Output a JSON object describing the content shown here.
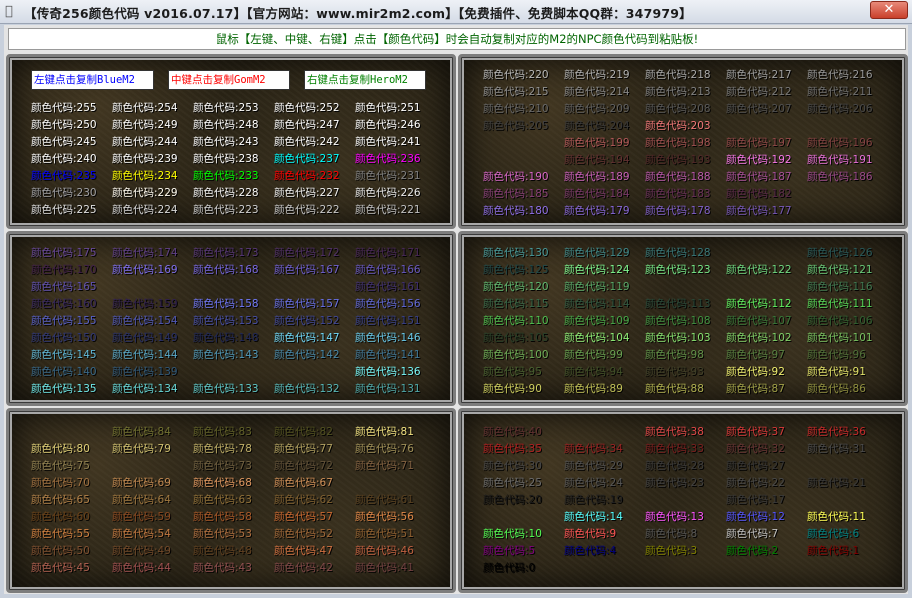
{
  "window": {
    "title": "【传奇256颜色代码 v2016.07.17】【官方网站：www.mir2m2.com】【免费插件、免费脚本QQ群：347979】",
    "close_label": "✕"
  },
  "notice": "鼠标【左键、中键、右键】点击【颜色代码】时会自动复制对应的M2的NPC颜色代码到粘贴板!",
  "buttons": {
    "blue": "左键点击复制BlueM2",
    "gom": "中键点击复制GomM2",
    "hero": "右键点击复制HeroM2"
  },
  "code_prefix": "颜色代码:",
  "palette": [
    "#000000",
    "#800000",
    "#008000",
    "#808000",
    "#000080",
    "#800080",
    "#008080",
    "#c0c0c0",
    "#555555",
    "#ff5555",
    "#55ff55",
    "#ffff55",
    "#5555ff",
    "#ff55ff",
    "#55ffff",
    "#ffffff",
    "#555555",
    "#393939",
    "#2f2f2f",
    "#222222",
    "#1a1a1a",
    "#383838",
    "#484848",
    "#404040",
    "#555555",
    "#6b6b6b",
    "#2a2a2a",
    "#353535",
    "#3a3a3a",
    "#505050",
    "#464646",
    "#4a4a4a",
    "#663333",
    "#7a1e1e",
    "#992222",
    "#b02020",
    "#c72a2a",
    "#d93a3a",
    "#e04848",
    "#b83838",
    "#603030",
    "#704040",
    "#804848",
    "#905050",
    "#a05050",
    "#b06050",
    "#c06040",
    "#d07040",
    "#604020",
    "#704828",
    "#805030",
    "#906030",
    "#a06838",
    "#b07040",
    "#c07840",
    "#d08040",
    "#e08848",
    "#c86830",
    "#a85828",
    "#884820",
    "#684018",
    "#584020",
    "#806030",
    "#907038",
    "#a07840",
    "#b08048",
    "#c08850",
    "#d09058",
    "#e09860",
    "#c08850",
    "#a07040",
    "#806040",
    "#605038",
    "#706040",
    "#807048",
    "#908050",
    "#a09058",
    "#b0a060",
    "#c0b068",
    "#d0c070",
    "#e0d078",
    "#f0e080",
    "#505020",
    "#606028",
    "#707030",
    "#808038",
    "#909040",
    "#a0a048",
    "#b0b050",
    "#c0c058",
    "#d0d060",
    "#e0e068",
    "#f0f070",
    "#404028",
    "#405028",
    "#486030",
    "#507038",
    "#588040",
    "#609048",
    "#68a050",
    "#70b058",
    "#78c060",
    "#80d068",
    "#88e070",
    "#90f078",
    "#284028",
    "#306030",
    "#387838",
    "#409040",
    "#48a848",
    "#50c050",
    "#58d858",
    "#60f060",
    "#284838",
    "#305840",
    "#386848",
    "#407850",
    "#488858",
    "#509860",
    "#58a868",
    "#60b870",
    "#68c878",
    "#70d880",
    "#78e888",
    "#80f890",
    "#204848",
    "#285858",
    "#306868",
    "#387878",
    "#408888",
    "#489898",
    "#50a8a8",
    "#58b8b8",
    "#60c8c8",
    "#68d8d8",
    "#70e8e8",
    "#78f8f8",
    "#203858",
    "#284868",
    "#305878",
    "#386888",
    "#407898",
    "#4888a8",
    "#5098b8",
    "#58a8c8",
    "#60b8d8",
    "#68c8e8",
    "#70d8f8",
    "#202858",
    "#283068",
    "#303878",
    "#384088",
    "#404898",
    "#4850a8",
    "#5058b8",
    "#5860c8",
    "#6068d8",
    "#6870e8",
    "#7078f8",
    "#302050",
    "#382860",
    "#403070",
    "#483880",
    "#504090",
    "#5848a0",
    "#6050b0",
    "#6858c0",
    "#7060d0",
    "#7868e0",
    "#8070f0",
    "#402048",
    "#482858",
    "#503068",
    "#583878",
    "#604088",
    "#684898",
    "#7050a8",
    "#7858b8",
    "#8060c8",
    "#8868d8",
    "#9070e8",
    "#482038",
    "#582848",
    "#683058",
    "#783868",
    "#884078",
    "#984888",
    "#a85098",
    "#b858a8",
    "#c860b8",
    "#d868c8",
    "#e870d8",
    "#f878e8",
    "#502828",
    "#603030",
    "#703838",
    "#804040",
    "#904848",
    "#a05050",
    "#b05858",
    "#c06060",
    "#d06868",
    "#e07070",
    "#f07878",
    "#383838",
    "#404040",
    "#484848",
    "#505050",
    "#585858",
    "#606060",
    "#686868",
    "#707070",
    "#787878",
    "#808080",
    "#888888",
    "#909090",
    "#989898",
    "#a0a0a0",
    "#a8a8a8",
    "#b0b0b0",
    "#b8b8b8",
    "#c0c0c0",
    "#c8c8c8",
    "#d0d0d0",
    "#d8d8d8",
    "#e0e0e0",
    "#e8e8e8",
    "#f0f0f0",
    "#f8f8f8",
    "#fffbf0",
    "#a0a0a4",
    "#808080",
    "#ff0000",
    "#00ff00",
    "#ffff00",
    "#0000ff",
    "#ff00ff",
    "#00ffff",
    "#ffffff"
  ],
  "panels": [
    {
      "name": "panel-255-221",
      "start": 255,
      "visible": [
        255,
        254,
        253,
        252,
        251,
        250,
        249,
        248,
        247,
        246,
        245,
        244,
        243,
        242,
        241,
        240,
        239,
        238,
        237,
        236,
        235,
        234,
        233,
        232,
        231,
        230,
        229,
        228,
        227,
        226,
        225,
        224,
        223,
        222,
        221
      ]
    },
    {
      "name": "panel-220-176",
      "start": 220,
      "visible": [
        220,
        219,
        218,
        217,
        216,
        215,
        214,
        213,
        212,
        211,
        210,
        209,
        208,
        207,
        206,
        205,
        204,
        203,
        199,
        198,
        197,
        196,
        194,
        193,
        192,
        191,
        190,
        189,
        188,
        187,
        186,
        185,
        184,
        183,
        182,
        180,
        179,
        178,
        177
      ]
    },
    {
      "name": "panel-175-131",
      "start": 175,
      "visible": [
        175,
        174,
        173,
        172,
        171,
        170,
        169,
        168,
        167,
        166,
        165,
        161,
        160,
        159,
        158,
        157,
        156,
        155,
        154,
        153,
        152,
        151,
        150,
        149,
        148,
        147,
        146,
        145,
        144,
        143,
        142,
        141,
        140,
        139,
        136,
        135,
        134,
        133,
        132,
        131
      ]
    },
    {
      "name": "panel-130-86",
      "start": 130,
      "visible": [
        130,
        129,
        128,
        126,
        125,
        124,
        123,
        122,
        121,
        120,
        119,
        116,
        115,
        114,
        113,
        112,
        111,
        110,
        109,
        108,
        107,
        106,
        105,
        104,
        103,
        102,
        101,
        100,
        99,
        98,
        97,
        96,
        95,
        94,
        93,
        92,
        91,
        90,
        89,
        88,
        87,
        86
      ]
    },
    {
      "name": "panel-85-41",
      "start": 85,
      "visible": [
        84,
        83,
        82,
        81,
        80,
        79,
        78,
        77,
        76,
        75,
        73,
        72,
        71,
        70,
        69,
        68,
        67,
        65,
        64,
        63,
        62,
        61,
        60,
        59,
        58,
        57,
        56,
        55,
        54,
        53,
        52,
        51,
        50,
        49,
        48,
        47,
        46,
        45,
        44,
        43,
        42,
        41
      ]
    },
    {
      "name": "panel-40-0",
      "start": 40,
      "visible": [
        40,
        38,
        37,
        36,
        35,
        34,
        33,
        32,
        31,
        30,
        29,
        28,
        27,
        25,
        24,
        23,
        22,
        21,
        20,
        19,
        17,
        14,
        13,
        12,
        11,
        10,
        9,
        8,
        7,
        6,
        5,
        4,
        3,
        2,
        1,
        0
      ]
    }
  ]
}
